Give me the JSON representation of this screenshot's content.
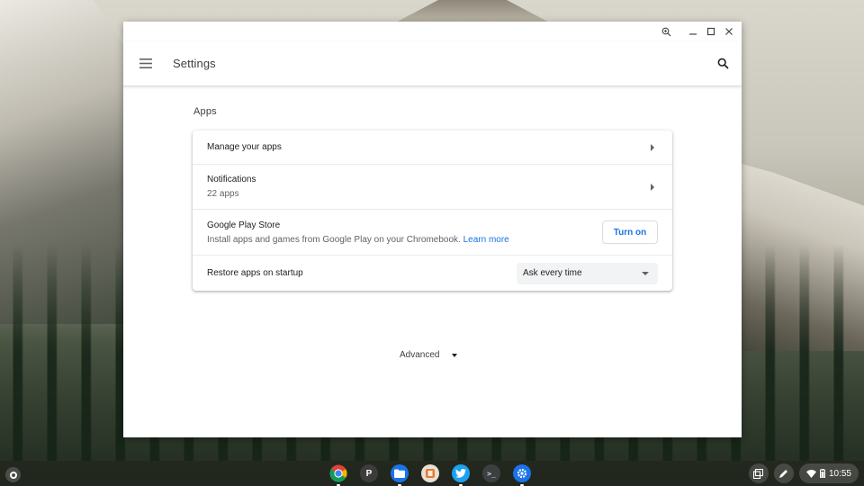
{
  "window": {
    "title": "Settings"
  },
  "section": {
    "title": "Apps"
  },
  "rows": {
    "manage_apps": {
      "label": "Manage your apps"
    },
    "notifications": {
      "label": "Notifications",
      "sublabel": "22 apps"
    },
    "play_store": {
      "label": "Google Play Store",
      "description": "Install apps and games from Google Play on your Chromebook.",
      "link": "Learn more",
      "button": "Turn on"
    },
    "restore": {
      "label": "Restore apps on startup",
      "selected": "Ask every time"
    }
  },
  "advanced": {
    "label": "Advanced"
  },
  "shelf": {
    "apps": [
      "chrome-icon",
      "p-app-icon",
      "files-icon",
      "app-icon",
      "twitter-icon",
      "terminal-icon",
      "settings-icon"
    ],
    "p_letter": "P",
    "terminal_glyph": ">_",
    "time": "10:55"
  },
  "colors": {
    "accent": "#1a73e8",
    "text": "#202124",
    "secondary": "#5f6368"
  }
}
